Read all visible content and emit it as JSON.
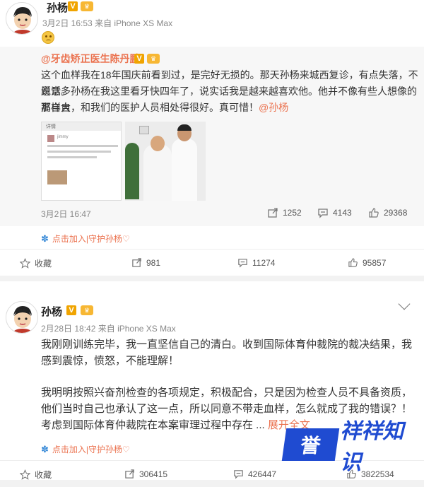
{
  "post1": {
    "user": "孙杨",
    "vip_badge": "V",
    "date": "3月2日 16:53",
    "source": "来自 iPhone XS Max",
    "emoji": "sad-face",
    "repost": {
      "author": "@牙齿矫正医生陈丹鹏",
      "text_line1": "这个血样我在18年国庆前看到过，是完好无损的。那天孙杨来城西复诊，有点失落，不愿意多",
      "text_line2": "说话。孙杨在我这里看牙快四年了，说实话我是越来越喜欢他。他并不像有些人想像的那样自",
      "text_line3_pre": "高自大，和我们的医护人员相处得很好。真可惜！",
      "mention": "@孙杨",
      "image1_header": "详情",
      "image1_name": "jimmy",
      "time": "3月2日 16:47",
      "reposts": "1252",
      "comments": "4143",
      "likes": "29368"
    },
    "topic": "点击加入|守护孙杨♡",
    "actions": {
      "favorite": "收藏",
      "repost": "981",
      "comment": "11274",
      "like": "95857"
    }
  },
  "post2": {
    "user": "孙杨",
    "vip_badge": "V",
    "date": "2月28日 18:42",
    "source": "来自 iPhone XS Max",
    "para1_line1": "我刚刚训练完毕，我一直坚信自己的清白。收到国际体育仲裁院的裁决结果，我",
    "para1_line2": "感到震惊，愤怒，不能理解！",
    "para2_line1": "我明明按照兴奋剂检查的各项规定，积极配合，只是因为检查人员不具备资质，",
    "para2_line2": "他们当时自己也承认了这一点，所以同意不带走血样，怎么就成了我的错误？！",
    "para2_line3": "考虑到国际体育仲裁院在本案审理过程中存在 ...",
    "expand": "展开全文",
    "topic": "点击加入|守护孙杨♡",
    "actions": {
      "favorite": "收藏",
      "repost": "306415",
      "comment": "426447",
      "like": "3822534"
    }
  },
  "watermark": {
    "box": "誉",
    "text": "祥祥知识"
  },
  "colors": {
    "link": "#eb7350",
    "vip": "#f0a400",
    "topic_icon": "#3a8bd8",
    "watermark": "#1f4bd1"
  }
}
